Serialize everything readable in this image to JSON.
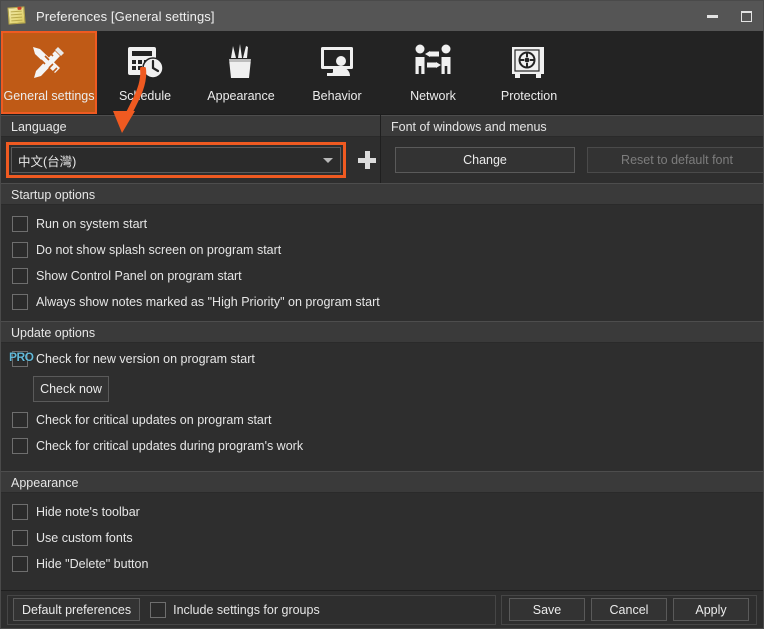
{
  "window": {
    "title": "Preferences [General settings]",
    "icon": "note-icon",
    "controls": {
      "minimize": "minimize",
      "maximize": "maximize"
    }
  },
  "toolbar": {
    "tabs": [
      {
        "label": "General settings",
        "icon": "pencil-ruler-icon",
        "active": true
      },
      {
        "label": "Schedule",
        "icon": "calendar-clock-icon",
        "active": false
      },
      {
        "label": "Appearance",
        "icon": "pen-cup-icon",
        "active": false
      },
      {
        "label": "Behavior",
        "icon": "monitor-person-icon",
        "active": false
      },
      {
        "label": "Network",
        "icon": "people-arrows-icon",
        "active": false
      },
      {
        "label": "Protection",
        "icon": "safe-vault-icon",
        "active": false
      }
    ]
  },
  "language": {
    "section_title": "Language",
    "selected": "中文(台灣)",
    "add_button": "+"
  },
  "font": {
    "section_title": "Font of windows and menus",
    "change_label": "Change",
    "reset_label": "Reset to default font",
    "reset_disabled": true
  },
  "startup": {
    "section_title": "Startup options",
    "options": [
      {
        "label": "Run on system start",
        "checked": false
      },
      {
        "label": "Do not show splash screen on program start",
        "checked": false
      },
      {
        "label": "Show Control Panel on program start",
        "checked": false
      },
      {
        "label": "Always show notes marked as \"High Priority\" on program start",
        "checked": false
      }
    ]
  },
  "update": {
    "section_title": "Update options",
    "pro_badge": "PRO",
    "new_version_option": {
      "label": "Check for new version on program start",
      "checked": false
    },
    "check_now_label": "Check now",
    "options": [
      {
        "label": "Check for critical updates on program start",
        "checked": false
      },
      {
        "label": "Check for critical updates during program's work",
        "checked": false
      }
    ]
  },
  "appearance": {
    "section_title": "Appearance",
    "options": [
      {
        "label": "Hide note's toolbar",
        "checked": false
      },
      {
        "label": "Use custom fonts",
        "checked": false
      },
      {
        "label": "Hide \"Delete\" button",
        "checked": false
      }
    ]
  },
  "footer": {
    "default_preferences_label": "Default preferences",
    "include_groups_label": "Include settings for groups",
    "include_groups_checked": false,
    "save_label": "Save",
    "cancel_label": "Cancel",
    "apply_label": "Apply"
  },
  "annotation": {
    "type": "curved-arrow",
    "color": "#ef5a21",
    "points_to": "language-combobox",
    "highlight_color": "#ef5a21"
  },
  "colors": {
    "accent": "#ef5a21",
    "active_tab_bg": "#bf5a16",
    "window_bg": "#2e2e2e",
    "toolbar_bg": "#232323",
    "titlebar_bg": "#555555",
    "section_header_bg": "#3a3a3a",
    "pro_badge": "#63b9d8"
  }
}
